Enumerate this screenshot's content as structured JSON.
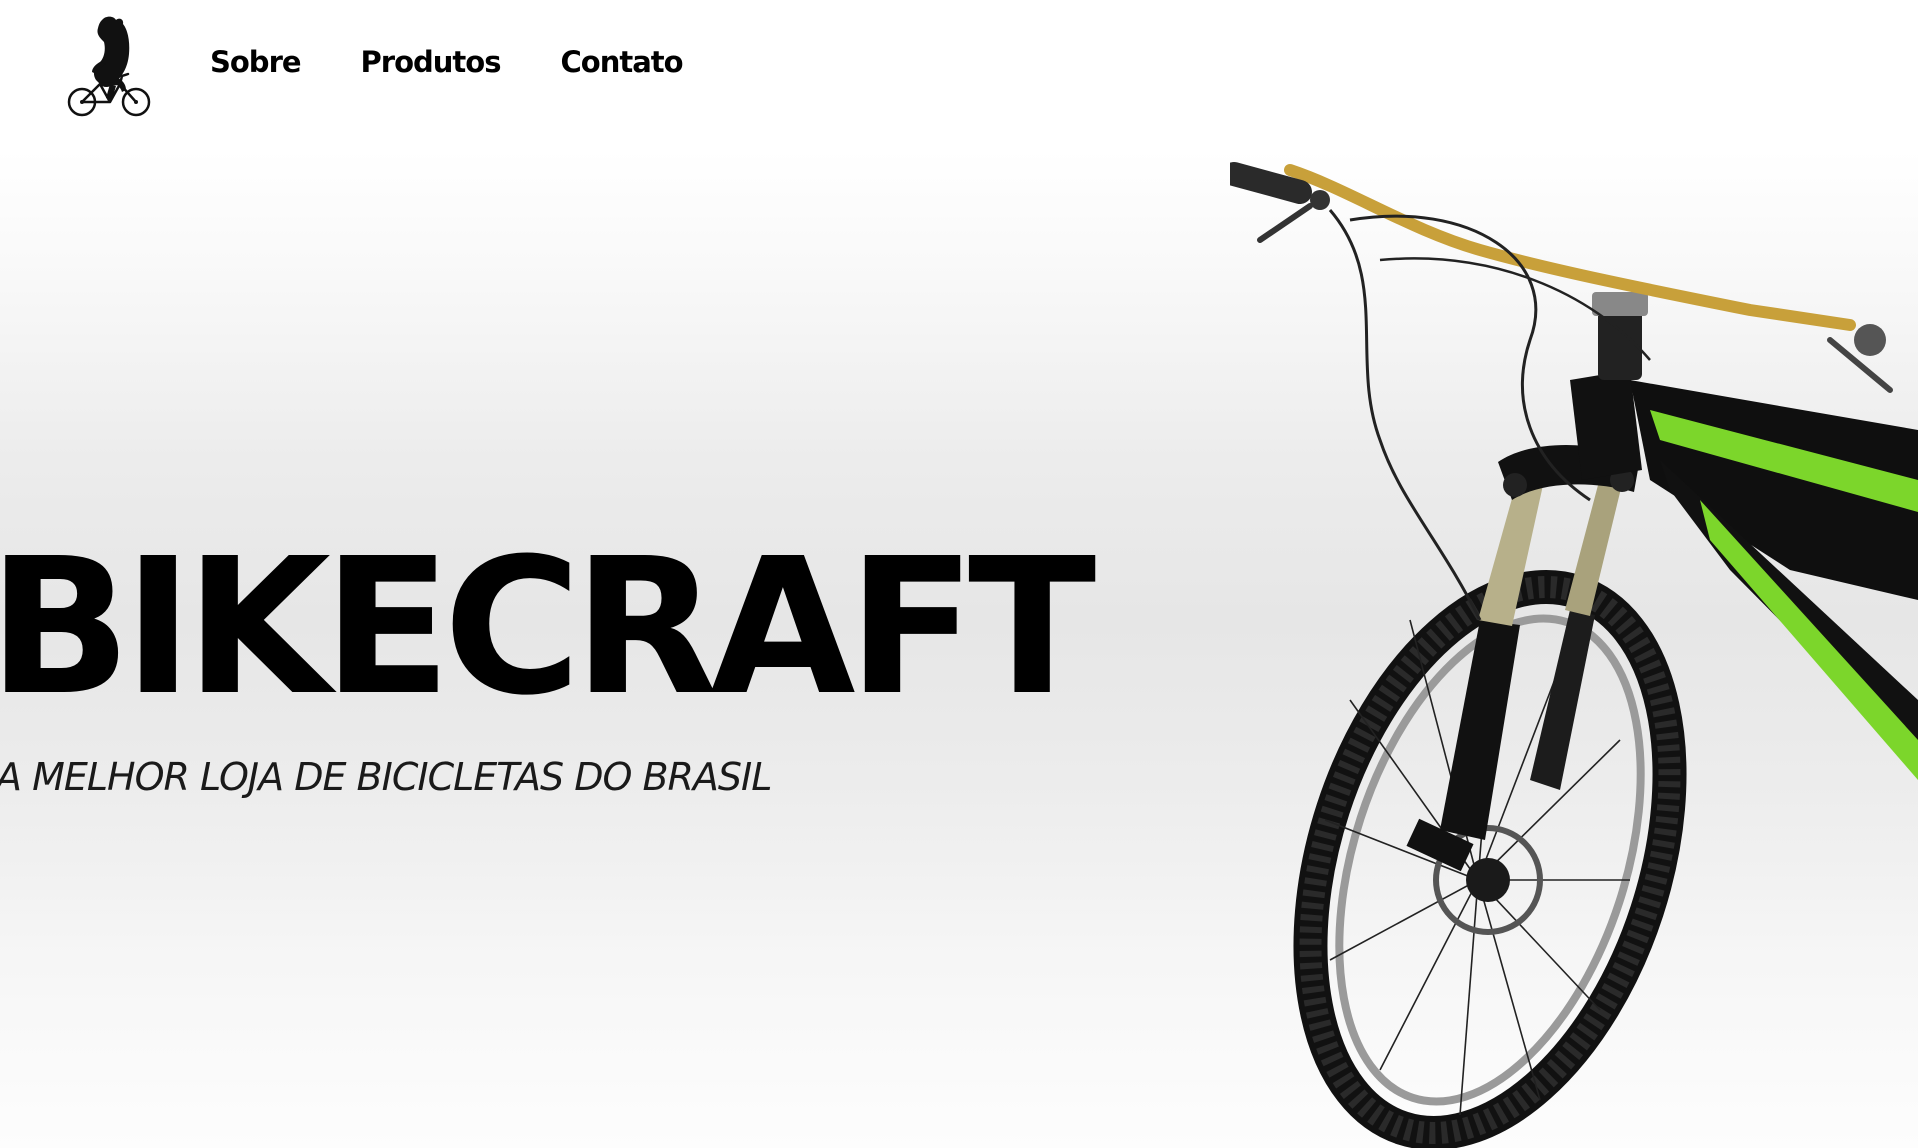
{
  "header": {
    "logo": {
      "icon": "bear-riding-bicycle-icon"
    },
    "nav": [
      {
        "label": "Sobre"
      },
      {
        "label": "Produtos"
      },
      {
        "label": "Contato"
      }
    ]
  },
  "hero": {
    "title": "BIKECRAFT",
    "subtitle": "A MELHOR LOJA DE BICICLETAS DO BRASIL",
    "image": {
      "icon": "mountain-bike-image"
    }
  },
  "colors": {
    "text": "#000000",
    "frame_accent": "#7cd62b",
    "handlebar": "#c8a03a",
    "fork": "#b7b08a"
  }
}
